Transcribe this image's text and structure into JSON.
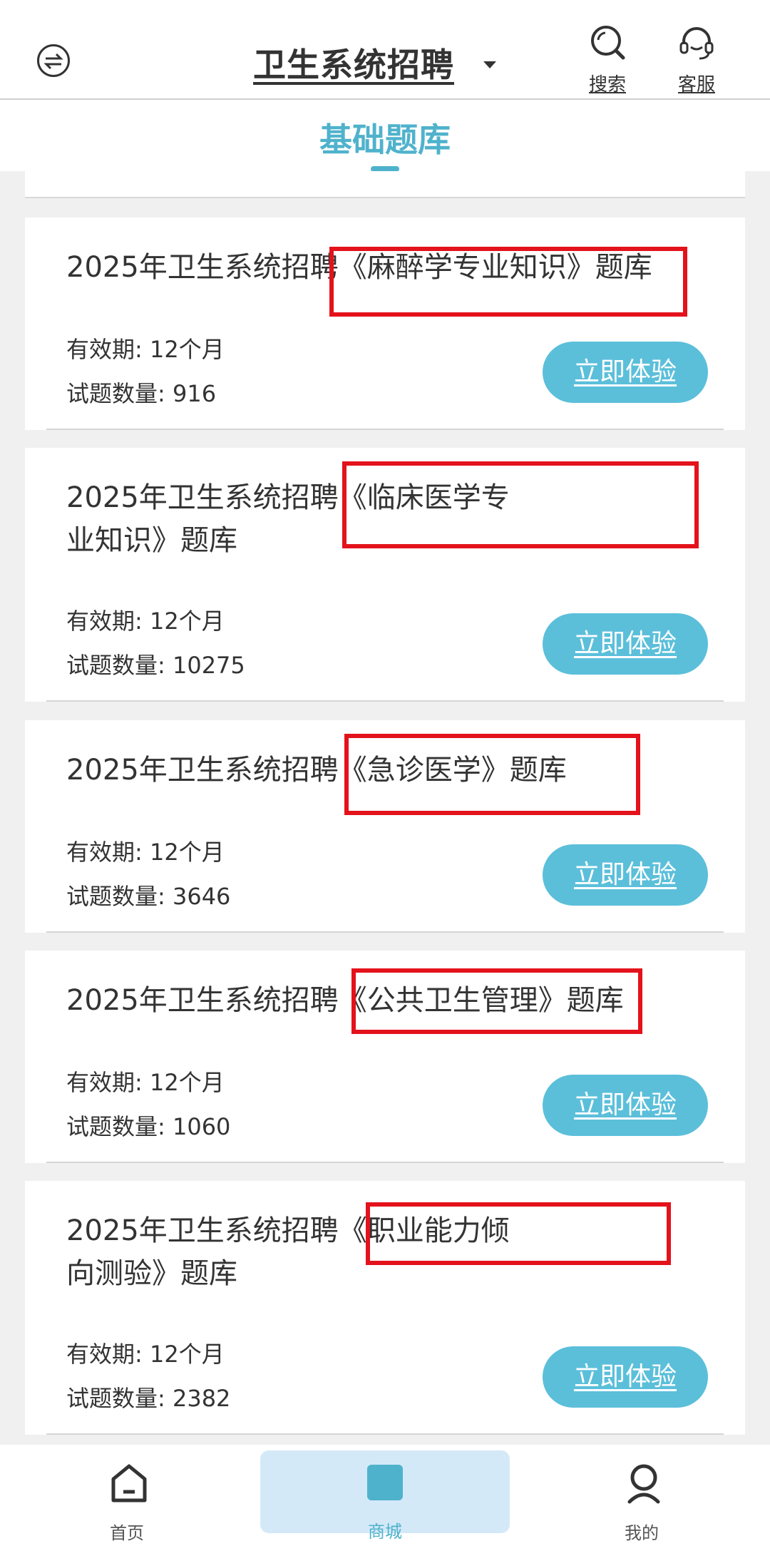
{
  "header": {
    "title": "卫生系统招聘",
    "search_label": "搜索",
    "service_label": "客服"
  },
  "section": {
    "title": "基础题库"
  },
  "cards": [
    {
      "title": "2025年卫生系统招聘《麻醉学专业知识》题库",
      "validity_label": "有效期: ",
      "validity": "12个月",
      "count_label": "试题数量: ",
      "count": "916",
      "cta": "立即体验"
    },
    {
      "title": "2025年卫生系统招聘《临床医学专业知识》题库",
      "validity_label": "有效期: ",
      "validity": "12个月",
      "count_label": "试题数量: ",
      "count": "10275",
      "cta": "立即体验"
    },
    {
      "title": "2025年卫生系统招聘《急诊医学》题库",
      "validity_label": "有效期: ",
      "validity": "12个月",
      "count_label": "试题数量: ",
      "count": "3646",
      "cta": "立即体验"
    },
    {
      "title": "2025年卫生系统招聘《公共卫生管理》题库",
      "validity_label": "有效期: ",
      "validity": "12个月",
      "count_label": "试题数量: ",
      "count": "1060",
      "cta": "立即体验"
    },
    {
      "title": "2025年卫生系统招聘《职业能力倾向测验》题库",
      "validity_label": "有效期: ",
      "validity": "12个月",
      "count_label": "试题数量: ",
      "count": "2382",
      "cta": "立即体验"
    }
  ],
  "bottom_nav": {
    "home_label": "首页",
    "mall_label": "商城",
    "mine_label": "我的",
    "active": "商城"
  },
  "colors": {
    "accent": "#4fb2cc",
    "button": "#5bbfda",
    "highlight_box": "#e3121b",
    "active_tab_bg": "#d4e9f8"
  },
  "icons": [
    "switch-icon",
    "search-icon",
    "headset-icon",
    "home-icon",
    "mall-icon",
    "user-icon"
  ]
}
